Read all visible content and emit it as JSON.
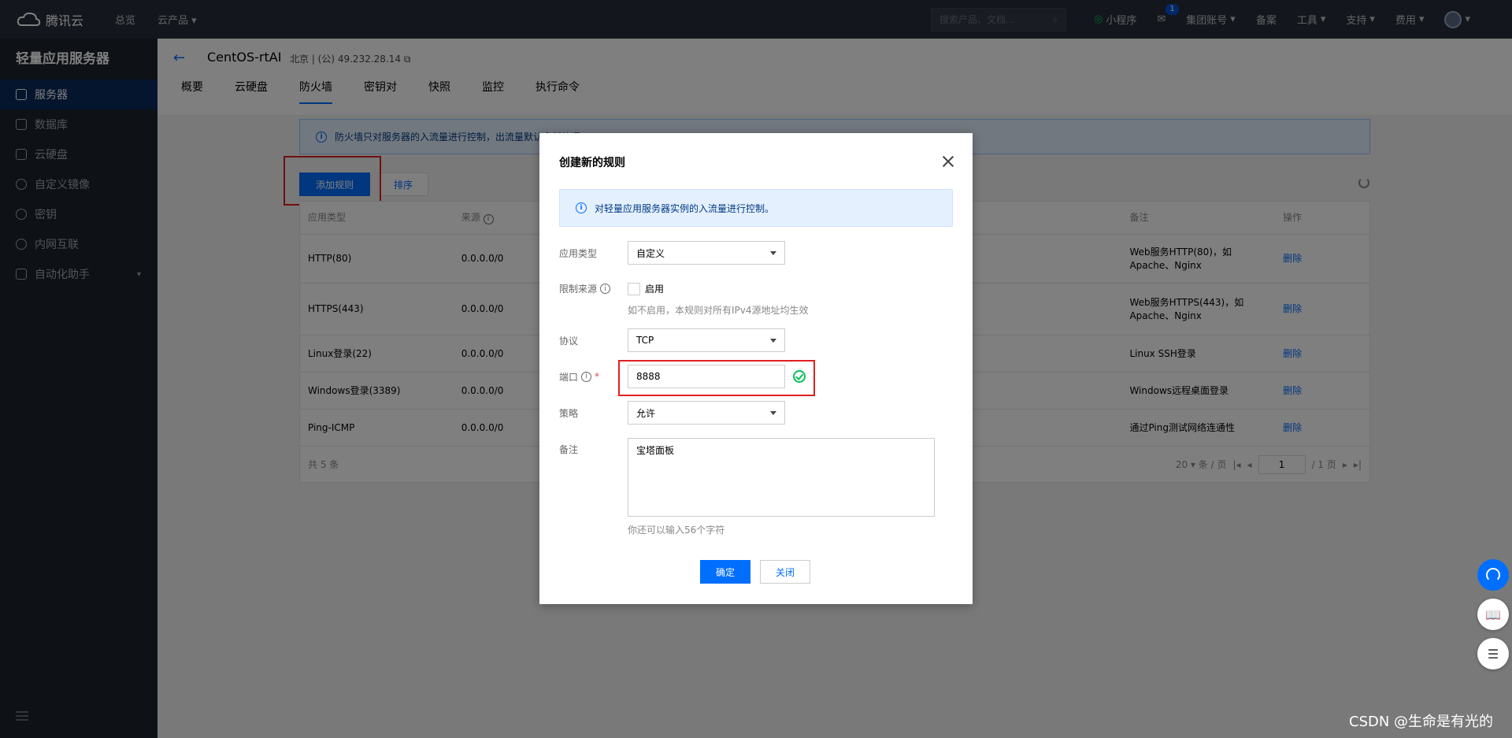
{
  "topbar": {
    "logo_text": "腾讯云",
    "nav": [
      "总览",
      "云产品"
    ],
    "search_placeholder": "搜索产品、文档...",
    "right_items": [
      "小程序",
      "集团账号",
      "备案",
      "工具",
      "支持",
      "费用"
    ],
    "badge_count": "1"
  },
  "sidebar": {
    "title": "轻量应用服务器",
    "items": [
      {
        "label": "服务器",
        "active": true
      },
      {
        "label": "数据库"
      },
      {
        "label": "云硬盘"
      },
      {
        "label": "自定义镜像"
      },
      {
        "label": "密钥"
      },
      {
        "label": "内网互联"
      },
      {
        "label": "自动化助手"
      }
    ]
  },
  "header": {
    "title": "CentOS-rtAI",
    "ip": "北京 | (公) 49.232.28.14",
    "tabs": [
      "概要",
      "云硬盘",
      "防火墙",
      "密钥对",
      "快照",
      "监控",
      "执行命令"
    ],
    "active_tab": "防火墙"
  },
  "notice": "防火墙只对服务器的入流量进行控制，出流量默认全部放通。",
  "toolbar": {
    "add_label": "添加规则",
    "sort_label": "排序"
  },
  "table": {
    "headers": [
      "应用类型",
      "来源",
      "",
      "备注",
      "操作"
    ],
    "rows": [
      {
        "type": "HTTP(80)",
        "source": "0.0.0.0/0",
        "note": "Web服务HTTP(80)，如Apache、Nginx",
        "op": "删除"
      },
      {
        "type": "HTTPS(443)",
        "source": "0.0.0.0/0",
        "note": "Web服务HTTPS(443)，如Apache、Nginx",
        "op": "删除"
      },
      {
        "type": "Linux登录(22)",
        "source": "0.0.0.0/0",
        "note": "Linux SSH登录",
        "op": "删除"
      },
      {
        "type": "Windows登录(3389)",
        "source": "0.0.0.0/0",
        "note": "Windows远程桌面登录",
        "op": "删除"
      },
      {
        "type": "Ping-ICMP",
        "source": "0.0.0.0/0",
        "note": "通过Ping测试网络连通性",
        "op": "删除"
      }
    ],
    "footer": {
      "total": "共 5 条",
      "page_size": "20 ▾ 条 / 页",
      "page": "1",
      "pages": "/ 1 页"
    }
  },
  "dialog": {
    "title": "创建新的规则",
    "notice": "对轻量应用服务器实例的入流量进行控制。",
    "app_type_label": "应用类型",
    "app_type_value": "自定义",
    "limit_label": "限制来源",
    "limit_checkbox": "启用",
    "limit_hint": "如不启用，本规则对所有IPv4源地址均生效",
    "protocol_label": "协议",
    "protocol_value": "TCP",
    "port_label": "端口",
    "port_value": "8888",
    "policy_label": "策略",
    "policy_value": "允许",
    "note_label": "备注",
    "note_value": "宝塔面板",
    "note_hint": "你还可以输入56个字符",
    "ok_label": "确定",
    "close_label": "关闭"
  },
  "watermark": "CSDN @生命是有光的",
  "colors": {
    "primary": "#006eff",
    "success": "#0abf5b",
    "highlight": "#e02020"
  }
}
